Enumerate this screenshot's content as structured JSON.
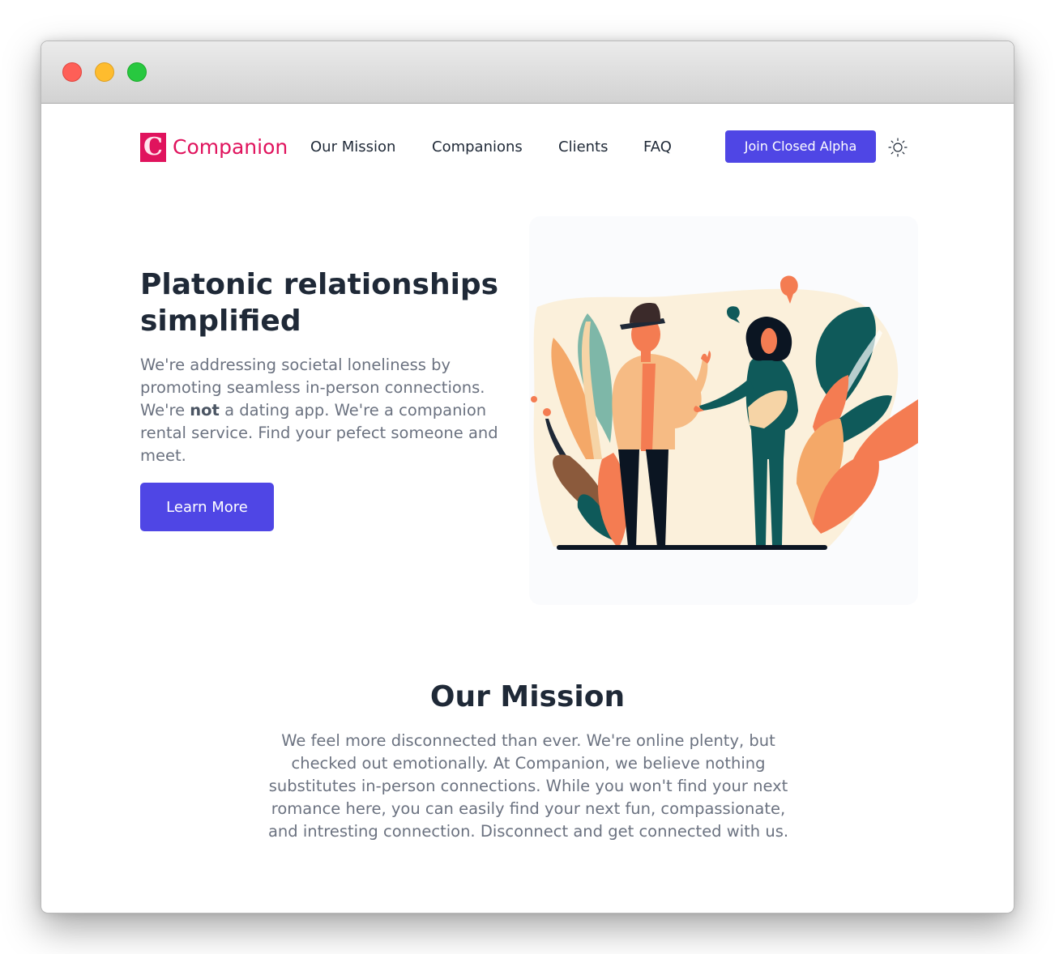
{
  "window": {
    "controls": [
      "close",
      "minimize",
      "zoom"
    ]
  },
  "nav": {
    "logo_letter": "C",
    "brand": "Companion",
    "links": [
      "Our Mission",
      "Companions",
      "Clients",
      "FAQ"
    ],
    "cta_label": "Join Closed Alpha",
    "theme_icon": "sun-icon"
  },
  "hero": {
    "title": "Platonic relationships simplified",
    "text_before": "We're addressing societal loneliness by promoting seamless in-person connections. We're ",
    "text_bold": "not",
    "text_after": " a dating app. We're a companion rental service. Find your pefect someone and meet.",
    "button_label": "Learn More",
    "illustration": "two-people-meeting-illustration"
  },
  "mission": {
    "title": "Our Mission",
    "text": "We feel more disconnected than ever. We're online plenty, but checked out emotionally. At Companion, we believe nothing substitutes in-person connections. While you won't find your next romance here, you can easily find your next fun, compassionate, and intresting connection. Disconnect and get connected with us."
  },
  "colors": {
    "brand": "#e0135d",
    "accent": "#4f46e5",
    "heading": "#1f2937",
    "body_text": "#6b7280"
  }
}
